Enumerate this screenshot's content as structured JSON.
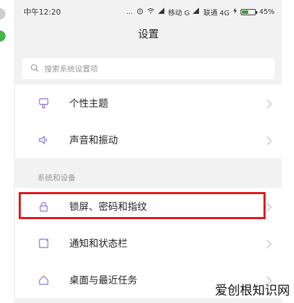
{
  "status_bar": {
    "carrier_time": "中午12:20",
    "dots": "...",
    "network1": "移动 G",
    "network2": "联通 4G",
    "battery": "45%"
  },
  "header": {
    "title": "设置"
  },
  "search": {
    "placeholder": "搜索系统设置项"
  },
  "section1": {
    "items": [
      {
        "label": "个性主题",
        "icon": "theme-brush-icon"
      },
      {
        "label": "声音和振动",
        "icon": "speaker-icon"
      }
    ]
  },
  "section2": {
    "header": "系统和设备",
    "items": [
      {
        "label": "锁屏、密码和指纹",
        "icon": "lock-icon"
      },
      {
        "label": "通知和状态栏",
        "icon": "notification-icon"
      },
      {
        "label": "桌面与最近任务",
        "icon": "home-icon"
      }
    ]
  },
  "watermark": "爱创根知识网",
  "colors": {
    "icon_accent": "#8a6fd6",
    "highlight": "#e0161b",
    "battery": "#3c9b3c"
  }
}
